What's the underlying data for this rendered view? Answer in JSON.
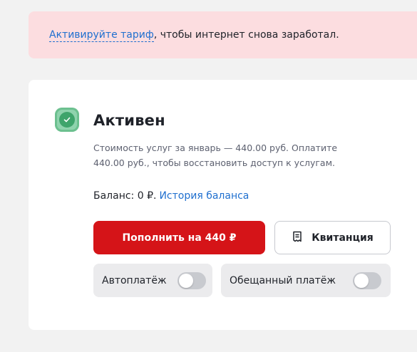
{
  "alert": {
    "link_text": "Активируйте тариф",
    "text": ", чтобы интернет снова заработал."
  },
  "status": {
    "icon": "check-icon",
    "title": "Активен",
    "description": "Стоимость услуг за январь — 440.00 руб. Оплатите 440.00 руб., чтобы восстановить доступ к услугам."
  },
  "balance": {
    "label": "Баланс: 0 ₽.",
    "history_link": "История баланса"
  },
  "actions": {
    "pay_label": "Пополнить на 440 ₽",
    "receipt_label": "Квитанция",
    "receipt_icon": "receipt-icon"
  },
  "toggles": {
    "autopay": {
      "label": "Автоплатёж",
      "enabled": false
    },
    "promised_payment": {
      "label": "Обещанный платёж",
      "enabled": false
    }
  },
  "colors": {
    "accent_red": "#d51418",
    "link_blue": "#1f6fcf",
    "alert_bg": "#fcdde0",
    "status_green": "#3ea46b"
  }
}
